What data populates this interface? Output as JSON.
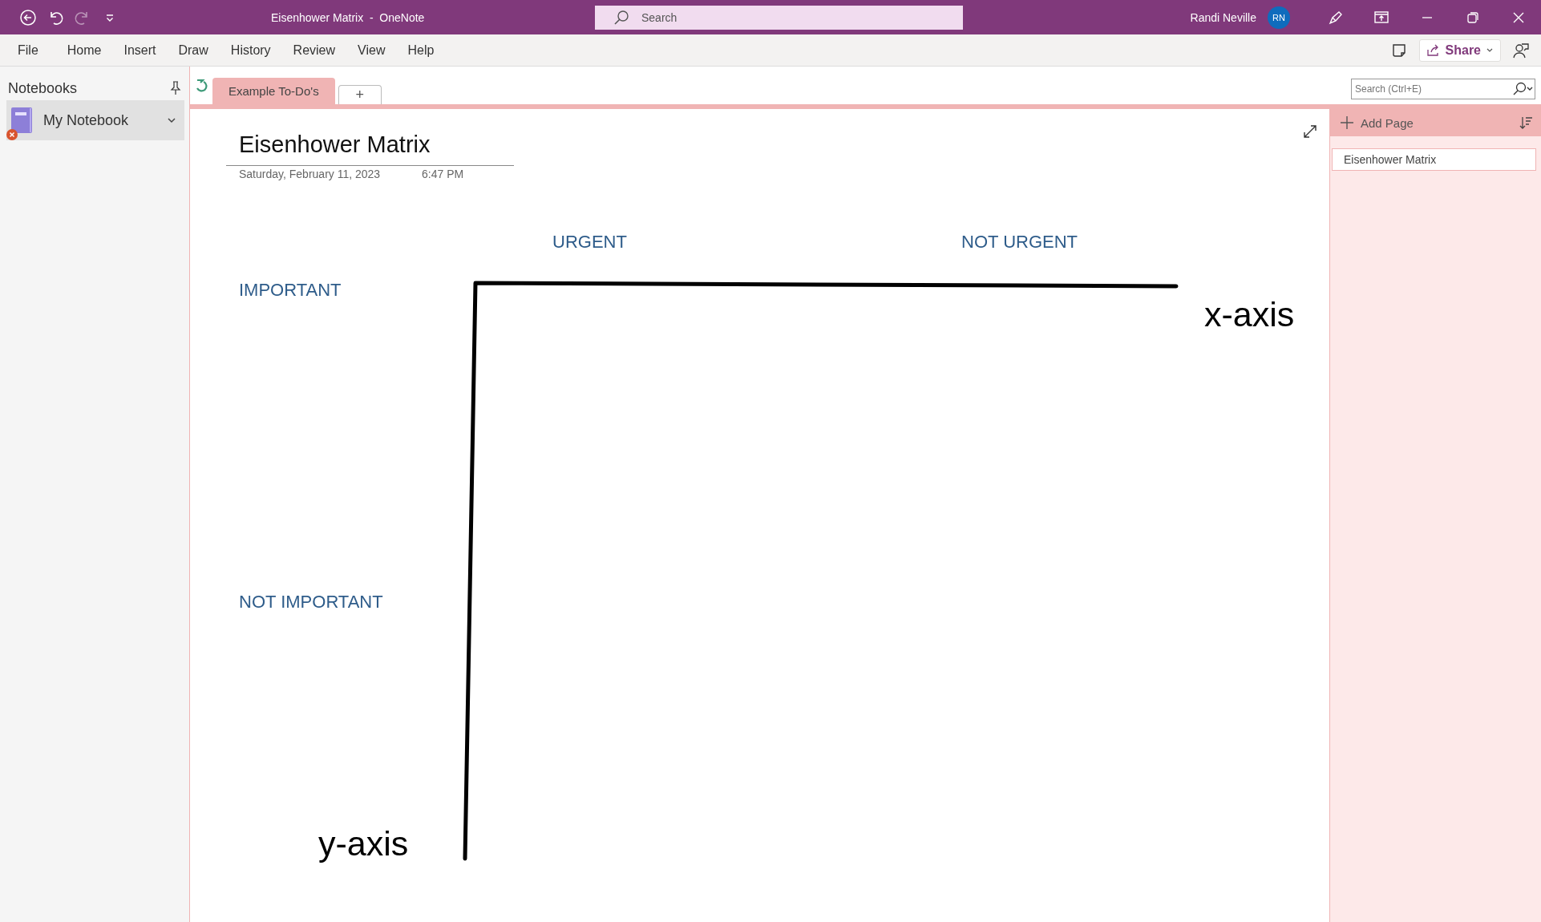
{
  "title_bar": {
    "title": "Eisenhower Matrix  -  OneNote",
    "search_placeholder": "Search",
    "user": "Randi Neville",
    "avatar_initials": "RN",
    "redo_disabled": true
  },
  "menu": [
    "File",
    "Home",
    "Insert",
    "Draw",
    "History",
    "Review",
    "View",
    "Help"
  ],
  "share_button": "Share",
  "notebooks": {
    "header": "Notebooks",
    "items": [
      {
        "name": "My Notebook",
        "selected": true,
        "sync_error": true
      }
    ]
  },
  "sections": [
    {
      "label": "Example To-Do's",
      "selected": true
    }
  ],
  "add_section": "+",
  "search_field": {
    "placeholder": "Search (Ctrl+E)"
  },
  "pages_panel": {
    "add_page": "Add Page",
    "pages": [
      {
        "title": "Eisenhower Matrix",
        "selected": true
      }
    ]
  },
  "page": {
    "title": "Eisenhower Matrix",
    "date": "Saturday, February 11, 2023",
    "time": "6:47 PM",
    "column_headers": [
      "URGENT",
      "NOT URGENT"
    ],
    "row_headers": [
      "IMPORTANT",
      "NOT IMPORTANT"
    ],
    "x_axis_label": "x-axis",
    "y_axis_label": "y-axis"
  }
}
